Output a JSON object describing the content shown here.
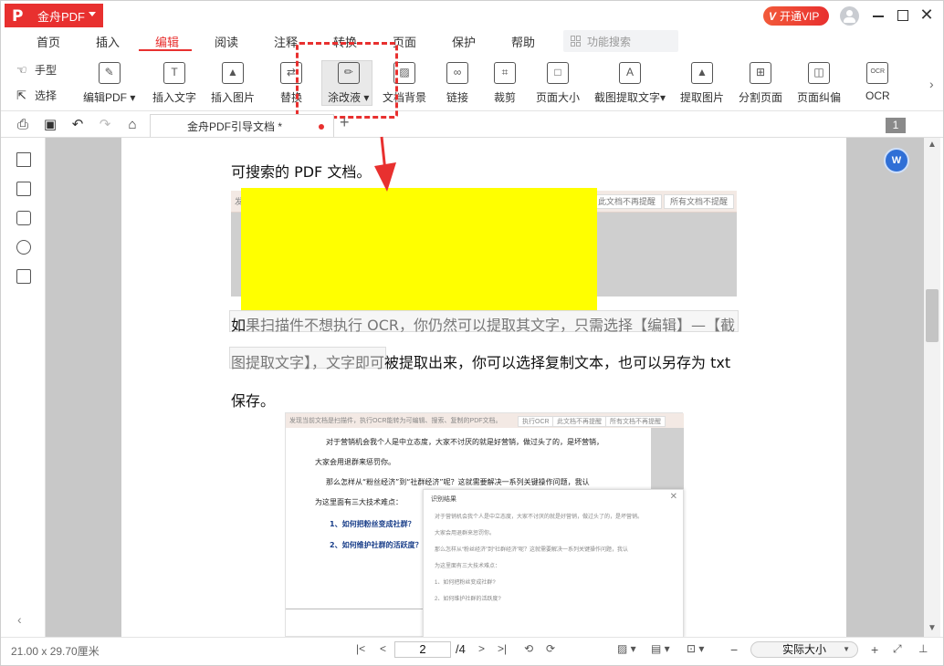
{
  "app": {
    "name": "金舟PDF",
    "vip_label": "开通VIP",
    "vip_mark": "V"
  },
  "window": {
    "close_glyph": "✕"
  },
  "menu": {
    "items": [
      {
        "label": "首页",
        "active": false
      },
      {
        "label": "插入",
        "active": false
      },
      {
        "label": "编辑",
        "active": true
      },
      {
        "label": "阅读",
        "active": false
      },
      {
        "label": "注释",
        "active": false
      },
      {
        "label": "转换",
        "active": false
      },
      {
        "label": "页面",
        "active": false
      },
      {
        "label": "保护",
        "active": false
      },
      {
        "label": "帮助",
        "active": false
      }
    ],
    "search_placeholder": "功能搜索"
  },
  "toolbar": {
    "hand_label": "手型",
    "select_label": "选择",
    "tools": [
      {
        "label": "编辑PDF",
        "glyph": "✎",
        "dropdown": true
      },
      {
        "label": "插入文字",
        "glyph": "T",
        "dropdown": false
      },
      {
        "label": "插入图片",
        "glyph": "▲",
        "dropdown": false
      },
      {
        "label": "替换",
        "glyph": "⇄",
        "dropdown": false
      },
      {
        "label": "涂改液",
        "glyph": "✏",
        "dropdown": true
      },
      {
        "label": "文档背景",
        "glyph": "▨",
        "dropdown": false
      },
      {
        "label": "链接",
        "glyph": "∞",
        "dropdown": false
      },
      {
        "label": "裁剪",
        "glyph": "⌗",
        "dropdown": false
      },
      {
        "label": "页面大小",
        "glyph": "□",
        "dropdown": false
      },
      {
        "label": "截图提取文字",
        "glyph": "A",
        "dropdown": true
      },
      {
        "label": "提取图片",
        "glyph": "▲",
        "dropdown": false
      },
      {
        "label": "分割页面",
        "glyph": "⊞",
        "dropdown": false
      },
      {
        "label": "页面纠偏",
        "glyph": "◫",
        "dropdown": false
      },
      {
        "label": "OCR",
        "glyph": "OCR",
        "dropdown": false
      }
    ]
  },
  "docbar": {
    "tab_title": "金舟PDF引导文档 *",
    "new_tab": "+",
    "page_count_badge": "1"
  },
  "document": {
    "line1": "可搜索的 PDF 文档。",
    "shot1_fragment": "发",
    "shot1_btn1": "此文档不再提醒",
    "shot1_btn2": "所有文档不提醒",
    "para_a_start": "如",
    "para_a_rest": "果扫描件不想执行 OCR，你仍然可以提取其文字，只需选择【编辑】—【截",
    "para_b_hl": "图提取文字】，文字即可",
    "para_b_rest": "被提取出来，你可以选择复制文本，也可以另存为 txt",
    "para_c": "保存。",
    "shot2": {
      "bar_text": "发现当前文档是扫描件，执行OCR能转为可编辑、搜索、复制的PDF文档。",
      "btn1": "执行OCR",
      "btn2": "此文档不再提醒",
      "btn3": "所有文档不再提醒",
      "lines": [
        "对于营销机会我个人是中立态度，大家不讨厌的就是好营销，做过头了的，是坏营销，",
        "大家会用退群来惩罚你。",
        "那么怎样从“粉丝经济”到“社群经济”呢？这就需要解决一系列关键操作问题，我认",
        "为这里面有三大技术难点：",
        "1、如何把粉丝变成社群？",
        "2、如何维护社群的活跃度？"
      ],
      "result_title": "识别结果",
      "result_lines": [
        "对于营销机会我个人是中立态度，大家不讨厌的就是好营销，做过头了的，是坏营销。",
        "大家会用退群来惩罚你。",
        "那么怎样从“粉丝经济”到“社群经济”呢？这就需要解决一系列关键操作问题，我认",
        "为这里面有三大技术难点：",
        "1、如何把粉丝变成社群?",
        "2、如何维护社群的活跃度?"
      ]
    }
  },
  "status": {
    "page_size": "21.00 x 29.70厘米",
    "current_page": "2",
    "total_pages": "/4",
    "zoom": "实际大小"
  },
  "colors": {
    "brand_red": "#e8302f",
    "highlight_yellow": "#ffff00",
    "ocr_blue": "#2f6fd6"
  }
}
